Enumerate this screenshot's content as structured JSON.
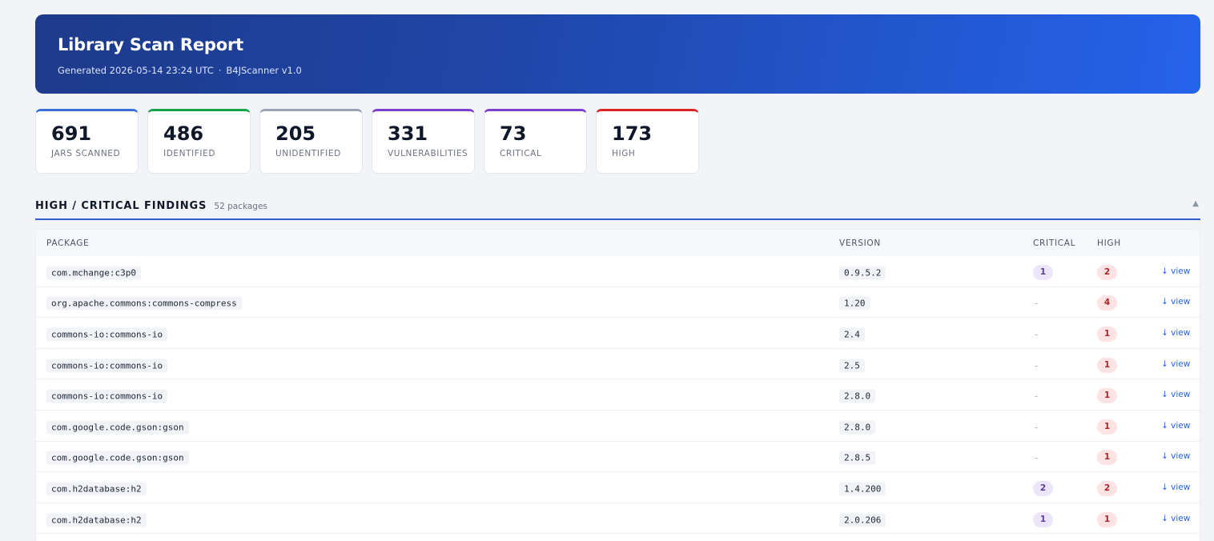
{
  "header": {
    "title": "Library Scan Report",
    "generated": "Generated 2026-05-14 23:24 UTC",
    "separator": "·",
    "tool": "B4JScanner v1.0"
  },
  "stats": [
    {
      "value": "691",
      "label": "JARS SCANNED",
      "color": "#3b6fd8"
    },
    {
      "value": "486",
      "label": "IDENTIFIED",
      "color": "#16a34a"
    },
    {
      "value": "205",
      "label": "UNIDENTIFIED",
      "color": "#9aa3b5"
    },
    {
      "value": "331",
      "label": "VULNERABILITIES",
      "color": "#7e3fd0"
    },
    {
      "value": "73",
      "label": "CRITICAL",
      "color": "#7e3fd0"
    },
    {
      "value": "173",
      "label": "HIGH",
      "color": "#dc2626"
    }
  ],
  "section": {
    "title": "HIGH / CRITICAL FINDINGS",
    "count": "52 packages",
    "toggle": "▲"
  },
  "table": {
    "columns": {
      "package": "PACKAGE",
      "version": "VERSION",
      "critical": "CRITICAL",
      "high": "HIGH"
    },
    "view_label": "↓ view",
    "empty": "-",
    "rows": [
      {
        "package": "com.mchange:c3p0",
        "version": "0.9.5.2",
        "critical": "1",
        "high": "2"
      },
      {
        "package": "org.apache.commons:commons-compress",
        "version": "1.20",
        "critical": "",
        "high": "4"
      },
      {
        "package": "commons-io:commons-io",
        "version": "2.4",
        "critical": "",
        "high": "1"
      },
      {
        "package": "commons-io:commons-io",
        "version": "2.5",
        "critical": "",
        "high": "1"
      },
      {
        "package": "commons-io:commons-io",
        "version": "2.8.0",
        "critical": "",
        "high": "1"
      },
      {
        "package": "com.google.code.gson:gson",
        "version": "2.8.0",
        "critical": "",
        "high": "1"
      },
      {
        "package": "com.google.code.gson:gson",
        "version": "2.8.5",
        "critical": "",
        "high": "1"
      },
      {
        "package": "com.h2database:h2",
        "version": "1.4.200",
        "critical": "2",
        "high": "2"
      },
      {
        "package": "com.h2database:h2",
        "version": "2.0.206",
        "critical": "1",
        "high": "1"
      }
    ]
  }
}
